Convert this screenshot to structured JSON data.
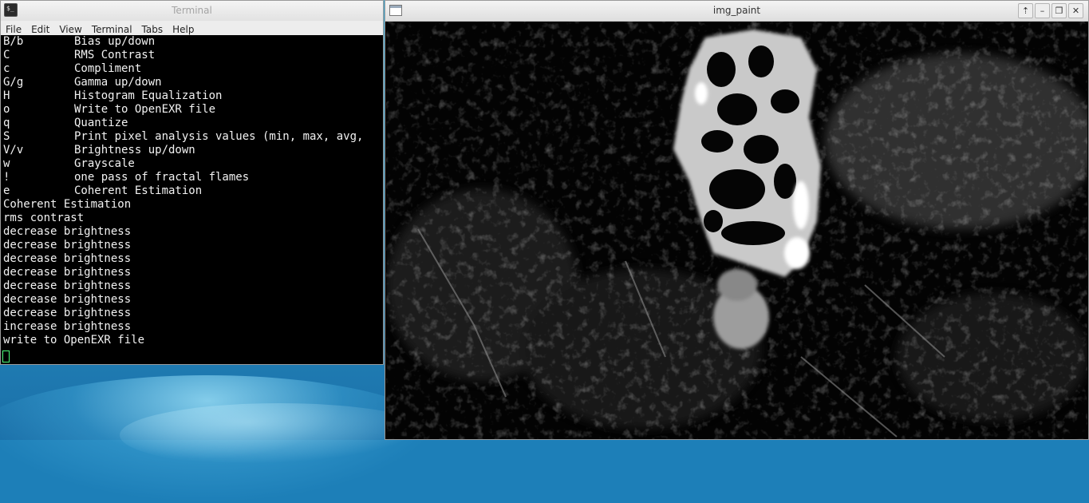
{
  "desktop": {
    "wallpaper": "blue-wave"
  },
  "terminal": {
    "title": "Terminal",
    "icon": "terminal-icon",
    "menu": [
      "File",
      "Edit",
      "View",
      "Terminal",
      "Tabs",
      "Help"
    ],
    "help_rows": [
      {
        "key": "B/b",
        "desc": "Bias up/down"
      },
      {
        "key": "C",
        "desc": "RMS Contrast"
      },
      {
        "key": "c",
        "desc": "Compliment"
      },
      {
        "key": "G/g",
        "desc": "Gamma up/down"
      },
      {
        "key": "H",
        "desc": "Histogram Equalization"
      },
      {
        "key": "o",
        "desc": "Write to OpenEXR file"
      },
      {
        "key": "q",
        "desc": "Quantize"
      },
      {
        "key": "S",
        "desc": "Print pixel analysis values (min, max, avg,"
      },
      {
        "key": "V/v",
        "desc": "Brightness up/down"
      },
      {
        "key": "w",
        "desc": "Grayscale"
      },
      {
        "key": "!",
        "desc": "one pass of fractal flames"
      },
      {
        "key": "e",
        "desc": "Coherent Estimation"
      }
    ],
    "log_lines": [
      "Coherent Estimation",
      "rms contrast",
      "decrease brightness",
      "decrease brightness",
      "decrease brightness",
      "decrease brightness",
      "decrease brightness",
      "decrease brightness",
      "decrease brightness",
      "increase brightness",
      "write to OpenEXR file"
    ]
  },
  "paint": {
    "title": "img_paint",
    "buttons": [
      {
        "name": "up-arrow-icon",
        "glyph": "⇡"
      },
      {
        "name": "minimize-icon",
        "glyph": "–"
      },
      {
        "name": "maximize-icon",
        "glyph": "❐"
      },
      {
        "name": "close-icon",
        "glyph": "✕"
      }
    ]
  }
}
